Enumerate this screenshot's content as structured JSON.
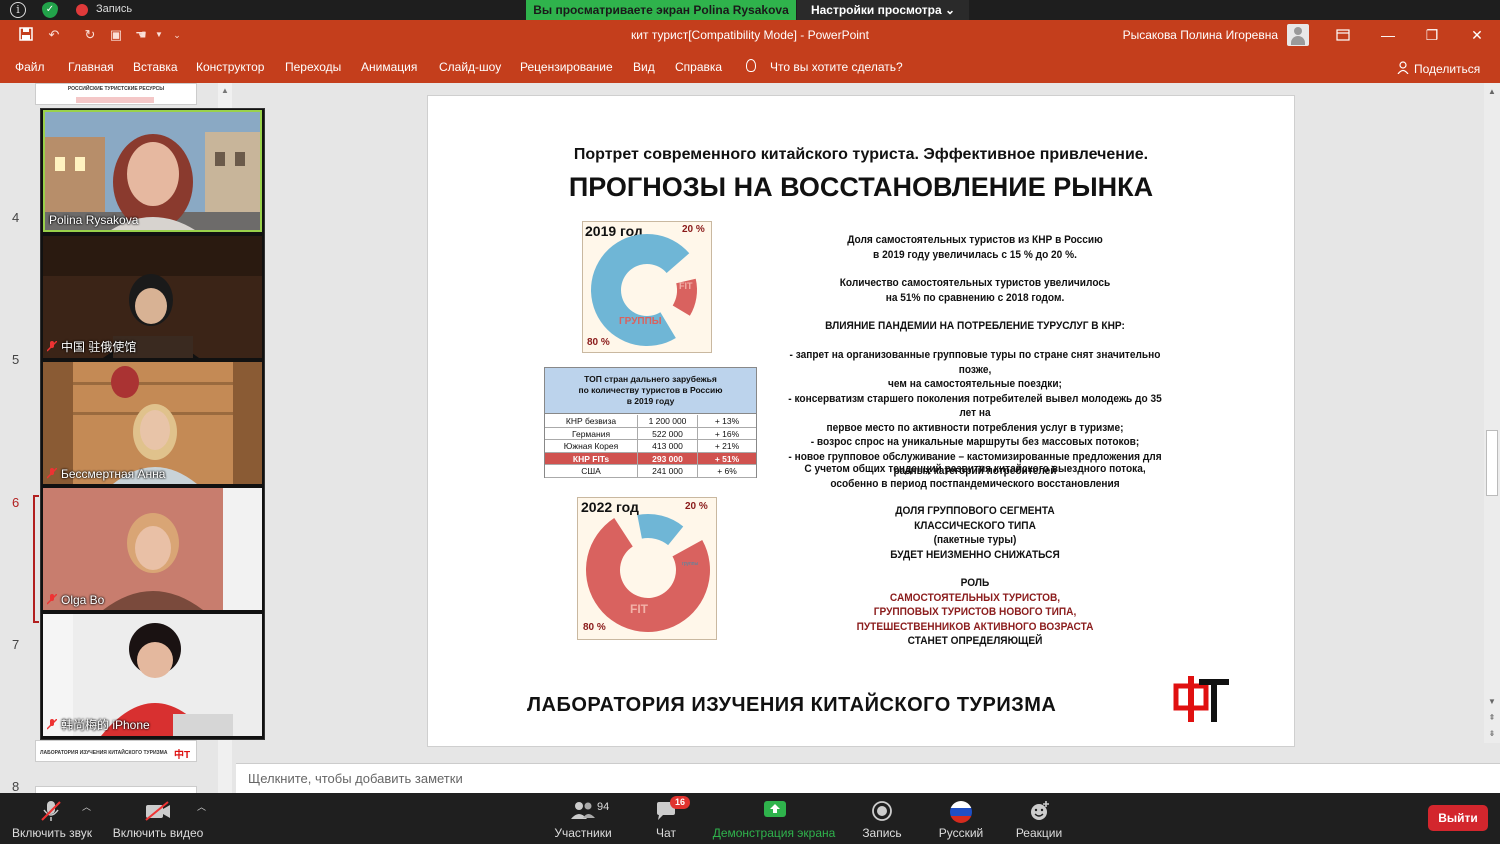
{
  "zoom_top": {
    "recording_label": "Запись",
    "viewing_banner": "Вы просматриваете экран Polina Rysakova",
    "view_settings": "Настройки просмотра ⌄"
  },
  "powerpoint": {
    "doc_title": "кит турист[Compatibility Mode]  -  PowerPoint",
    "user_name": "Рысакова Полина Игоревна",
    "menu": [
      "Файл",
      "Главная",
      "Вставка",
      "Конструктор",
      "Переходы",
      "Анимация",
      "Слайд-шоу",
      "Рецензирование",
      "Вид",
      "Справка"
    ],
    "search_prompt": "Что вы хотите сделать?",
    "share": "Поделиться",
    "notes_placeholder": "Щелкните, чтобы добавить заметки"
  },
  "thumbnails": {
    "slide_numbers": [
      "4",
      "5",
      "6",
      "7",
      "8"
    ],
    "top_thumb_text": "РОССИЙСКИЕ ТУРИСТСКИЕ РЕСУРСЫ",
    "bottom_thumb_text": "ЛАБОРАТОРИЯ ИЗУЧЕНИЯ КИТАЙСКОГО ТУРИЗМА",
    "bottom_thumb_logo": "中T"
  },
  "participants": [
    {
      "name": "Polina Rysakova",
      "muted": false
    },
    {
      "name": "中国 驻俄使馆",
      "muted": true
    },
    {
      "name": "Бессмертная Анна",
      "muted": true
    },
    {
      "name": "Olga Bo",
      "muted": true
    },
    {
      "name": "韩尚梅的 iPhone",
      "muted": true
    }
  ],
  "slide": {
    "subtitle": "Портрет современного китайского туриста. Эффективное привлечение.",
    "title": "ПРОГНОЗЫ НА ВОССТАНОВЛЕНИЕ РЫНКА",
    "bottom_banner": "ЛАБОРАТОРИЯ ИЗУЧЕНИЯ КИТАЙСКОГО ТУРИЗМА",
    "chart_data": [
      {
        "type": "pie",
        "title": "2019 год",
        "categories": [
          "ГРУППЫ",
          "FIT"
        ],
        "values": [
          80,
          20
        ],
        "labels": [
          "80 %",
          "20 %"
        ],
        "colors": {
          "groups": "#6fb6d6",
          "fit": "#d9625f"
        }
      },
      {
        "type": "pie",
        "title": "2022 год",
        "categories": [
          "FIT",
          "группы"
        ],
        "values": [
          80,
          20
        ],
        "labels": [
          "80 %",
          "20 %"
        ],
        "colors": {
          "fit": "#d9625f",
          "groups": "#6fb6d6"
        }
      },
      {
        "type": "table",
        "title": [
          "ТОП стран дальнего зарубежья",
          "по количеству туристов в Россию",
          "в 2019 году"
        ],
        "rows": [
          {
            "country": "КНР безвиза",
            "value": "1 200 000",
            "change": "+ 13%",
            "highlight": false
          },
          {
            "country": "Германия",
            "value": "522 000",
            "change": "+ 16%",
            "highlight": false
          },
          {
            "country": "Южная Корея",
            "value": "413 000",
            "change": "+ 21%",
            "highlight": false
          },
          {
            "country": "КНР FITs",
            "value": "293  000",
            "change": "+ 51%",
            "highlight": true
          },
          {
            "country": "США",
            "value": "241 000",
            "change": "+ 6%",
            "highlight": false
          }
        ]
      }
    ],
    "text": {
      "p1": [
        "Доля самостоятельных туристов из КНР в Россию",
        "в 2019 году увеличилась с 15 % до 20 %."
      ],
      "p2": [
        "Количество самостоятельных туристов увеличилось",
        "на 51% по сравнению с 2018 годом."
      ],
      "p3": "ВЛИЯНИЕ ПАНДЕМИИ НА ПОТРЕБЛЕНИЕ ТУРУСЛУГ В КНР:",
      "bullets": [
        "- запрет на организованные групповые туры по стране снят значительно позже,",
        "чем на самостоятельные поездки;",
        "- консерватизм старшего поколения потребителей вывел молодежь до 35 лет на",
        "первое место по активности потребления услуг в туризме;",
        "- возрос спрос на уникальные маршруты без массовых потоков;",
        "- новое групповое обслуживание – кастомизированные предложения для",
        "разных категорий потребителей"
      ],
      "p4": [
        "С учетом общих тенденций развития китайского выездного потока,",
        "особенно в период постпандемического восстановления"
      ],
      "p5": [
        "ДОЛЯ ГРУППОВОГО СЕГМЕНТА",
        "КЛАССИЧЕСКОГО ТИПА",
        "(пакетные туры)",
        "БУДЕТ НЕИЗМЕННО СНИЖАТЬСЯ"
      ],
      "p6_role": "РОЛЬ",
      "p6_red": [
        "САМОСТОЯТЕЛЬНЫХ ТУРИСТОВ,",
        "ГРУППОВЫХ ТУРИСТОВ НОВОГО ТИПА,",
        "ПУТЕШЕСТВЕННИКОВ АКТИВНОГО ВОЗРАСТА"
      ],
      "p6_end": "СТАНЕТ ОПРЕДЕЛЯЮЩЕЙ"
    }
  },
  "zoom_bar": {
    "unmute": "Включить звук",
    "start_video": "Включить видео",
    "participants": "Участники",
    "participants_count": "94",
    "chat": "Чат",
    "chat_badge": "16",
    "share_screen": "Демонстрация экрана",
    "record": "Запись",
    "language": "Русский",
    "reactions": "Реакции",
    "leave": "Выйти"
  }
}
